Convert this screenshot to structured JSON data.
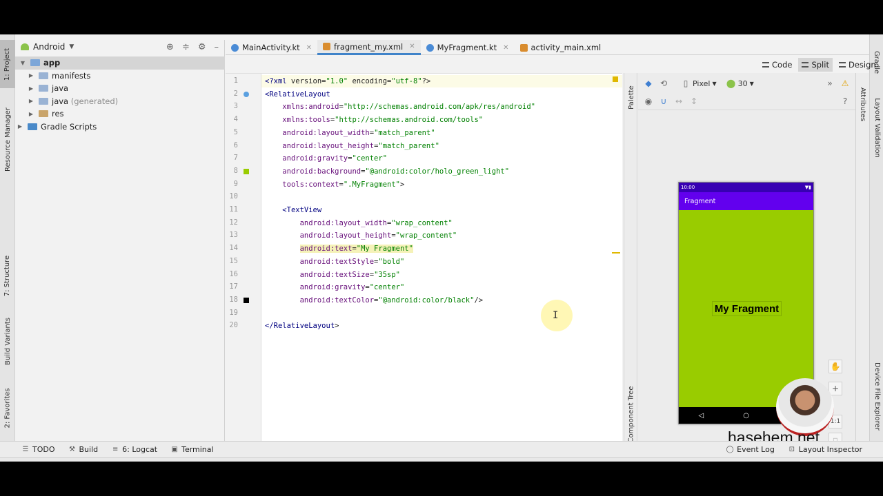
{
  "left_strip": {
    "project": "1: Project",
    "resource_manager": "Resource Manager",
    "structure": "7: Structure",
    "build_variants": "Build Variants",
    "favorites": "2: Favorites"
  },
  "right_strip": {
    "gradle": "Gradle",
    "layout_validation": "Layout Validation",
    "device_file_explorer": "Device File Explorer"
  },
  "project_panel": {
    "view_name": "Android",
    "tree": [
      {
        "label": "app",
        "note": ""
      },
      {
        "label": "manifests",
        "note": ""
      },
      {
        "label": "java",
        "note": ""
      },
      {
        "label": "java",
        "note": "(generated)"
      },
      {
        "label": "res",
        "note": ""
      },
      {
        "label": "Gradle Scripts",
        "note": ""
      }
    ]
  },
  "tabs": [
    {
      "label": "MainActivity.kt",
      "color": "#4a8bd6"
    },
    {
      "label": "fragment_my.xml",
      "color": "#d98c2e"
    },
    {
      "label": "MyFragment.kt",
      "color": "#4a8bd6"
    },
    {
      "label": "activity_main.xml",
      "color": "#d98c2e"
    }
  ],
  "view_modes": {
    "code": "Code",
    "split": "Split",
    "design": "Design"
  },
  "code_lines": [
    "<?xml version=\"1.0\" encoding=\"utf-8\"?>",
    "<RelativeLayout",
    "    xmlns:android=\"http://schemas.android.com/apk/res/android\"",
    "    xmlns:tools=\"http://schemas.android.com/tools\"",
    "    android:layout_width=\"match_parent\"",
    "    android:layout_height=\"match_parent\"",
    "    android:gravity=\"center\"",
    "    android:background=\"@android:color/holo_green_light\"",
    "    tools:context=\".MyFragment\">",
    "",
    "    <TextView",
    "        android:layout_width=\"wrap_content\"",
    "        android:layout_height=\"wrap_content\"",
    "        android:text=\"My Fragment\"",
    "        android:textStyle=\"bold\"",
    "        android:textSize=\"35sp\"",
    "        android:gravity=\"center\"",
    "        android:textColor=\"@android:color/black\"/>",
    "",
    "</RelativeLayout>"
  ],
  "design": {
    "palette": "Palette",
    "attributes": "Attributes",
    "component_tree": "Component Tree",
    "device": "Pixel",
    "api": "30",
    "phone": {
      "time": "10:00",
      "app_title": "Fragment",
      "text": "My Fragment",
      "background": "#99cc00"
    },
    "zoom_ratio": "1:1"
  },
  "watermark": "hasehem.net",
  "bottom_bar": {
    "todo": "TODO",
    "build": "Build",
    "logcat": "6: Logcat",
    "terminal": "Terminal",
    "event_log": "Event Log",
    "layout_inspector": "Layout Inspector"
  }
}
